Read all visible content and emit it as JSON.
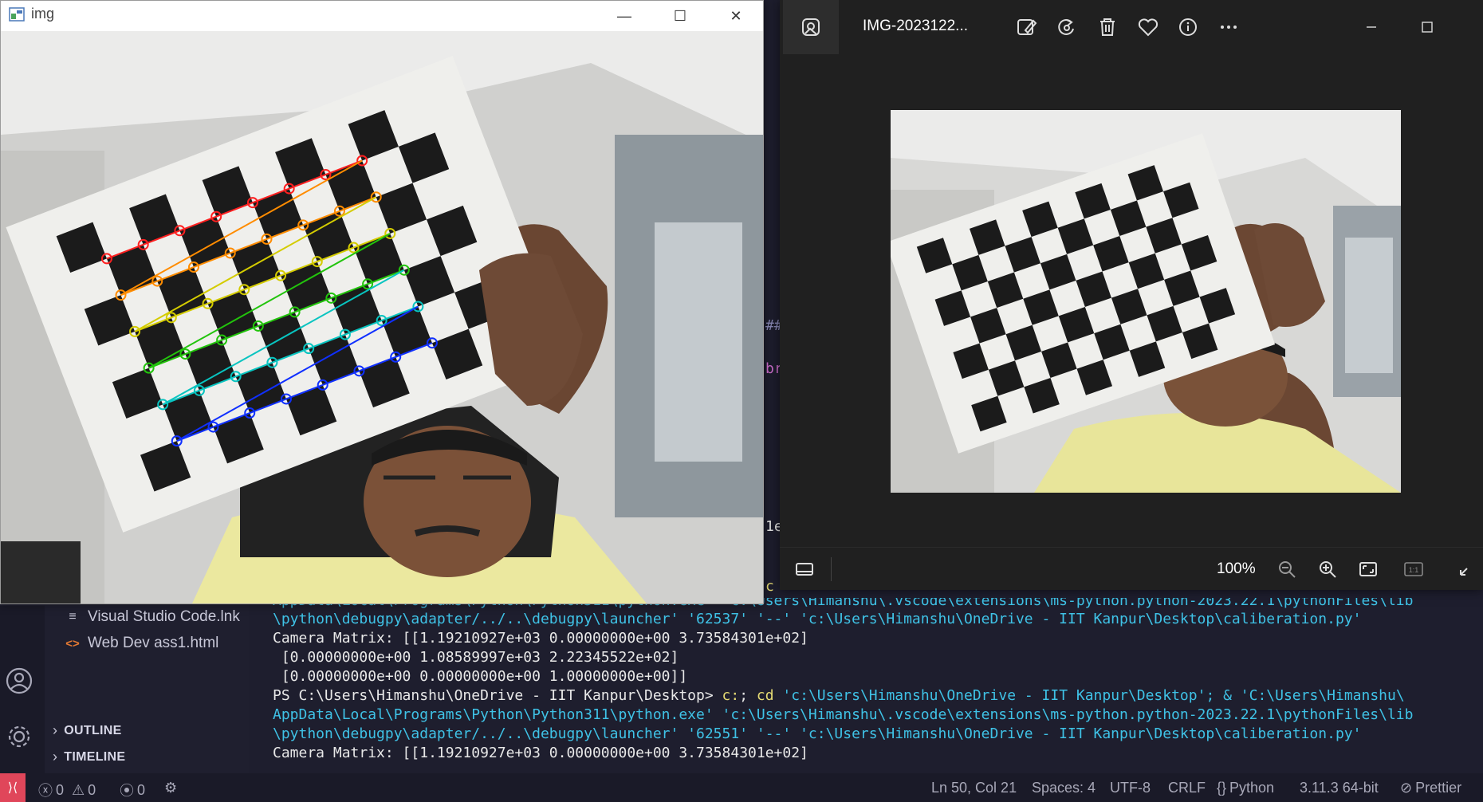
{
  "img_window": {
    "title": "img",
    "buttons": {
      "minimize": "—",
      "maximize": "☐",
      "close": "✕"
    }
  },
  "photos_viewer": {
    "file_title": "IMG-2023122...",
    "zoom_level": "100%",
    "icons": [
      "image-app-icon",
      "edit-image-icon",
      "rotate-icon",
      "delete-icon",
      "favorite-icon",
      "info-icon",
      "more-options-icon",
      "filmstrip-icon",
      "zoom-out-icon",
      "zoom-in-icon",
      "fit-to-window-icon",
      "actual-size-icon",
      "expand-icon"
    ],
    "actual_size_label": "1:1"
  },
  "explorer": {
    "files": [
      "Visual Studio Code.lnk",
      "Web Dev ass1.html"
    ],
    "sections": [
      "OUTLINE",
      "TIMELINE"
    ]
  },
  "editor_peek": {
    "chars": [
      "##",
      "br",
      "1e",
      "c"
    ]
  },
  "terminal": {
    "lines": [
      "AppData\\Local\\Programs\\Python\\Python311\\python.exe  'c:\\Users\\Himanshu\\.vscode\\extensions\\ms-python.python-2023.22.1\\pythonFiles\\lib",
      "\\python\\debugpy\\adapter/../..\\debugpy\\launcher' '62537' '--' 'c:\\Users\\Himanshu\\OneDrive - IIT Kanpur\\Desktop\\caliberation.py'",
      "Camera Matrix: [[1.19210927e+03 0.00000000e+00 3.73584301e+02]",
      " [0.00000000e+00 1.08589997e+03 2.22345522e+02]",
      " [0.00000000e+00 0.00000000e+00 1.00000000e+00]]",
      "\\python\\debugpy\\adapter/../..\\debugpy\\launcher' '62551' '--' 'c:\\Users\\Himanshu\\OneDrive - IIT Kanpur\\Desktop\\caliberation.py'",
      "Camera Matrix: [[1.19210927e+03 0.00000000e+00 3.73584301e+02]"
    ],
    "ps_prompt": "PS C:\\Users\\Himanshu\\OneDrive - IIT Kanpur\\Desktop> ",
    "ps_cmd_1": "c:",
    "ps_cmd_sep": "; ",
    "ps_cmd_2": "cd",
    "ps_cmd_3": " 'c:\\Users\\Himanshu\\OneDrive - IIT Kanpur\\Desktop'; & 'C:\\Users\\Himanshu\\",
    "ps_line_2": "AppData\\Local\\Programs\\Python\\Python311\\python.exe' 'c:\\Users\\Himanshu\\.vscode\\extensions\\ms-python.python-2023.22.1\\pythonFiles\\lib"
  },
  "status_bar": {
    "remote": "⟩⟨",
    "errors": "0",
    "warnings": "0",
    "ports": "0",
    "cursor": "Ln 50, Col 21",
    "spaces": "Spaces: 4",
    "encoding": "UTF-8",
    "eol": "CRLF",
    "language": "Python",
    "interpreter": "3.11.3 64-bit",
    "formatter": "Prettier"
  },
  "colors": {
    "row_colors": [
      "#ff2020",
      "#ff8c00",
      "#d4cc00",
      "#22c40c",
      "#08c4c0",
      "#1030ff"
    ],
    "terminal_cyan": "#3fc2e6",
    "terminal_yellow": "#e6db74"
  }
}
